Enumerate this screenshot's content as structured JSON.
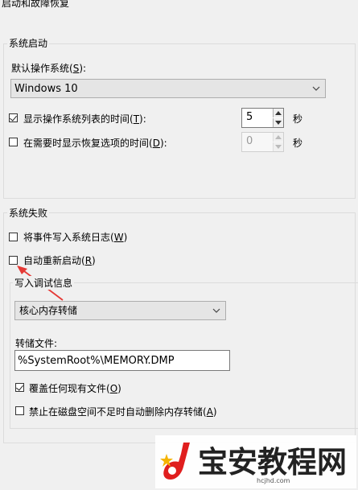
{
  "dialog": {
    "title": "启动和故障恢复"
  },
  "system_startup": {
    "legend": "系统启动",
    "default_os_label": "默认操作系统(",
    "default_os_key": "S",
    "default_os_suffix": "):",
    "default_os_value": "Windows 10",
    "show_list_label": "显示操作系统列表的时间(",
    "show_list_key": "T",
    "show_list_suffix": "):",
    "show_list_checked": true,
    "show_list_value": "5",
    "show_list_unit": "秒",
    "show_recovery_label": "在需要时显示恢复选项的时间(",
    "show_recovery_key": "D",
    "show_recovery_suffix": "):",
    "show_recovery_checked": false,
    "show_recovery_value": "0",
    "show_recovery_unit": "秒"
  },
  "system_failure": {
    "legend": "系统失败",
    "write_event_label": "将事件写入系统日志(",
    "write_event_key": "W",
    "write_event_suffix": ")",
    "write_event_checked": false,
    "auto_restart_label": "自动重新启动(",
    "auto_restart_key": "R",
    "auto_restart_suffix": ")",
    "auto_restart_checked": false,
    "debug_info": {
      "legend": "写入调试信息",
      "dump_type_value": "核心内存转储",
      "dump_file_label": "转储文件:",
      "dump_file_value": "%SystemRoot%\\MEMORY.DMP",
      "overwrite_label": "覆盖任何现有文件(",
      "overwrite_key": "O",
      "overwrite_suffix": ")",
      "overwrite_checked": true,
      "disable_auto_delete_label": "禁止在磁盘空间不足时自动删除内存转储(",
      "disable_auto_delete_key": "A",
      "disable_auto_delete_suffix": ")",
      "disable_auto_delete_checked": false
    }
  },
  "watermark": {
    "text": "宝安教程网",
    "url": "hcjhd.com"
  },
  "colors": {
    "arrow": "#e53935",
    "logo_red": "#e01e1e",
    "logo_yellow": "#f5b400"
  }
}
